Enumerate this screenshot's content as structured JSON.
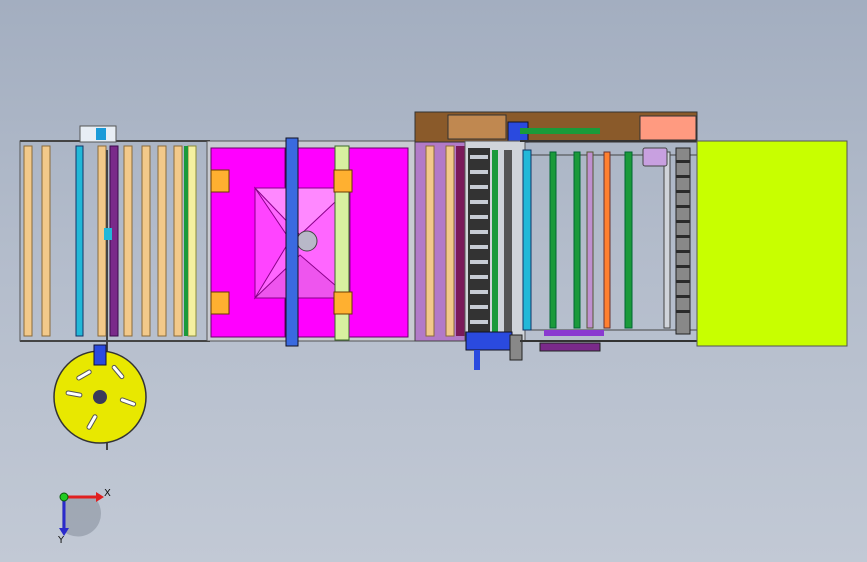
{
  "view": {
    "background": "#b0b9c8"
  },
  "colors": {
    "magenta": "#ff00ff",
    "magenta_light": "#ff66ff",
    "lime": "#c8ff00",
    "yellow": "#e8e800",
    "purple": "#7a2a8a",
    "brown": "#8a5a2a",
    "blue": "#2a4adf",
    "orange": "#ffa23a",
    "salmon": "#ff9a80",
    "tan": "#f2c98a",
    "green": "#1a9a3a",
    "cyan": "#22b8d8"
  },
  "triad": {
    "x_label": "X",
    "y_label": "Y",
    "x_color": "#e02020",
    "y_color": "#2a2acc",
    "origin_color": "#22cc22"
  },
  "icons": [
    "coordinate-triad-icon",
    "reel-disc-icon"
  ]
}
